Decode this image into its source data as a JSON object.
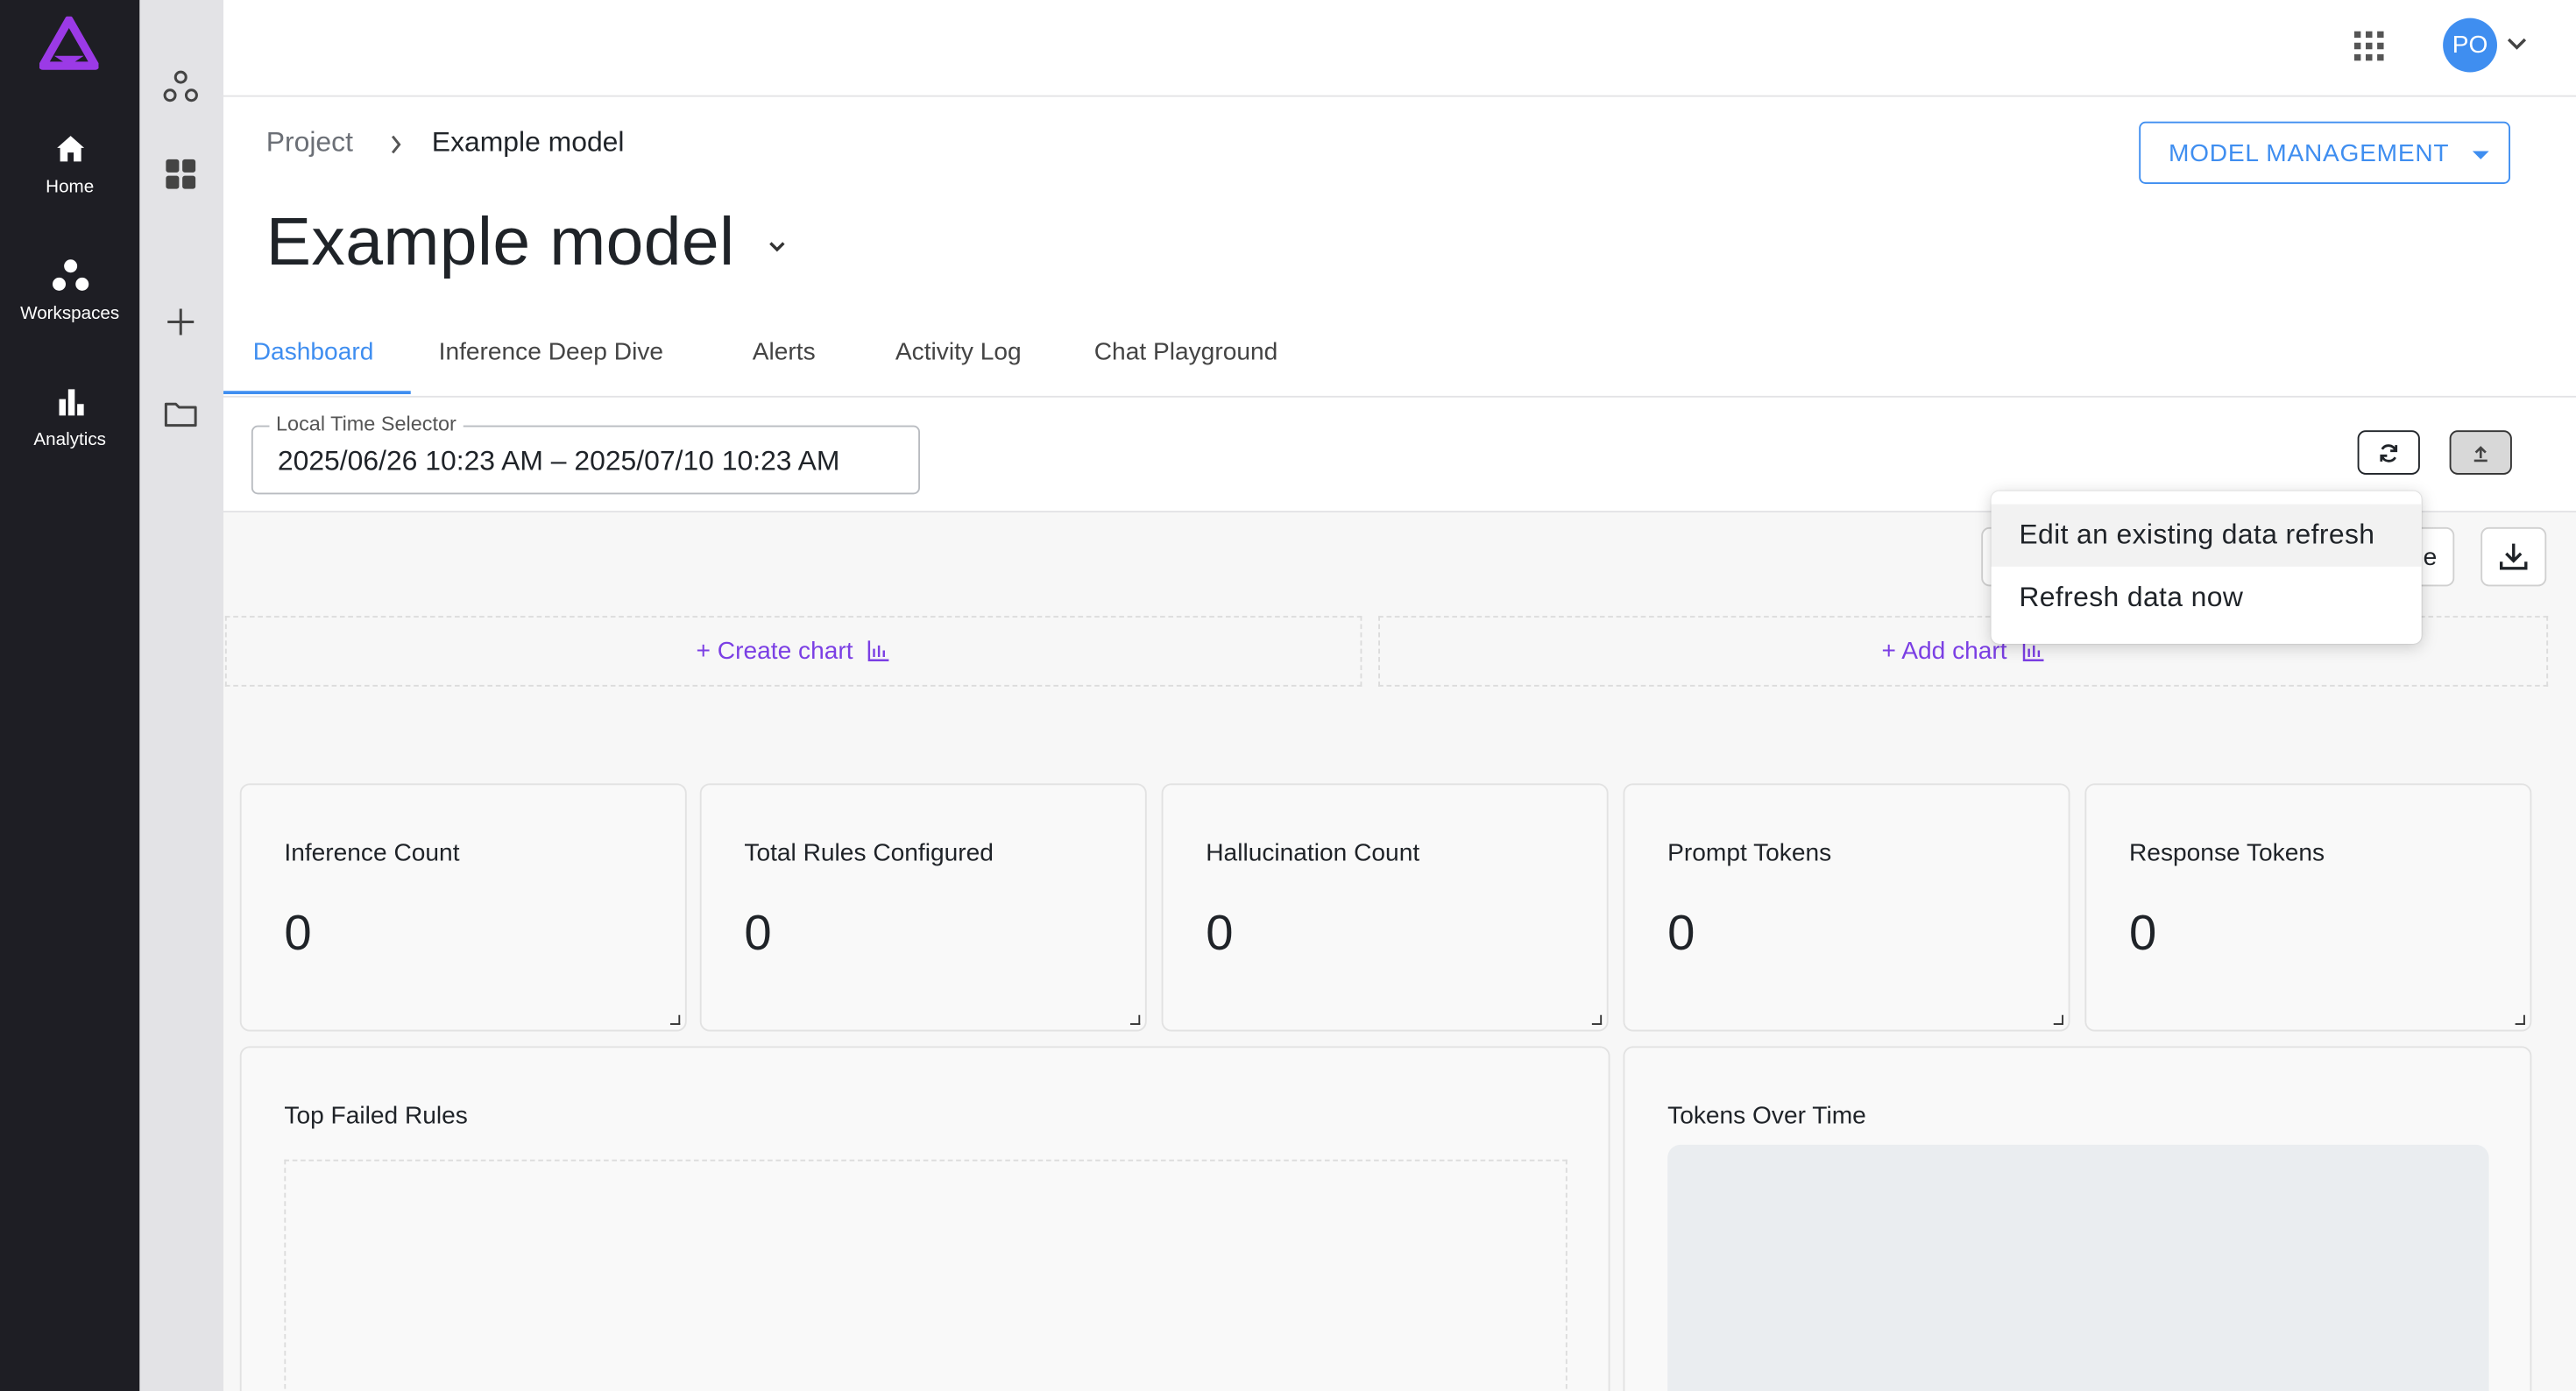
{
  "nav": {
    "items": [
      {
        "label": "Home",
        "icon": "home-icon"
      },
      {
        "label": "Workspaces",
        "icon": "workspaces-icon"
      },
      {
        "label": "Analytics",
        "icon": "analytics-icon"
      }
    ],
    "brand_color": "#9b3ae6"
  },
  "topbar": {
    "avatar_initials": "PO",
    "apps_icon": "grid-apps-icon"
  },
  "breadcrumb": {
    "root": "Project",
    "current": "Example model"
  },
  "page": {
    "title": "Example model",
    "model_management_label": "MODEL MANAGEMENT"
  },
  "tabs": [
    {
      "label": "Dashboard",
      "active": true
    },
    {
      "label": "Inference Deep Dive"
    },
    {
      "label": "Alerts"
    },
    {
      "label": "Activity Log"
    },
    {
      "label": "Chat Playground"
    }
  ],
  "time_selector": {
    "label": "Local Time Selector",
    "value": "2025/06/26 10:23 AM – 2025/07/10 10:23 AM"
  },
  "dashboard": {
    "create_chart_label": "+ Create chart",
    "add_chart_label": "+ Add chart",
    "hidden_button_tail": "e",
    "metrics": [
      {
        "title": "Inference Count",
        "value": "0"
      },
      {
        "title": "Total Rules Configured",
        "value": "0"
      },
      {
        "title": "Hallucination Count",
        "value": "0"
      },
      {
        "title": "Prompt Tokens",
        "value": "0"
      },
      {
        "title": "Response Tokens",
        "value": "0"
      }
    ],
    "panels": [
      {
        "title": "Top Failed Rules"
      },
      {
        "title": "Tokens Over Time"
      }
    ]
  },
  "refresh_menu": {
    "items": [
      {
        "label": "Edit an existing data refresh",
        "highlighted": true
      },
      {
        "label": "Refresh data now"
      }
    ]
  },
  "colors": {
    "accent": "#3f8ef0",
    "purple": "#7b3fe4",
    "nav_bg": "#1e1e24"
  }
}
